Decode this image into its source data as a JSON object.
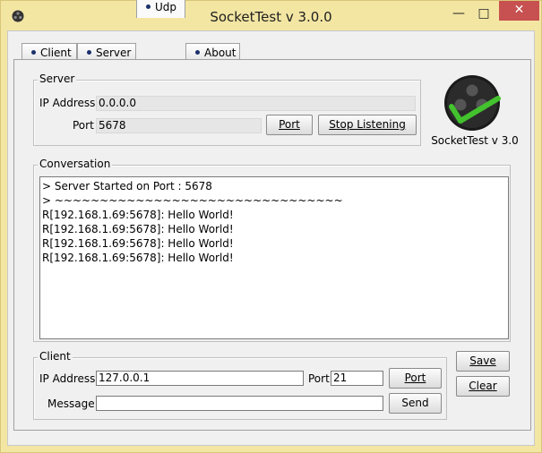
{
  "window": {
    "title": "SocketTest v 3.0.0"
  },
  "tabs": [
    {
      "label": "Client"
    },
    {
      "label": "Server"
    },
    {
      "label": "Udp"
    },
    {
      "label": "About"
    }
  ],
  "server": {
    "group_label": "Server",
    "ip_label": "IP Address",
    "ip_value": "0.0.0.0",
    "port_label": "Port",
    "port_value": "5678",
    "port_button": "Port",
    "stop_button": "Stop Listening"
  },
  "logo": {
    "caption": "SocketTest v 3.0"
  },
  "conversation": {
    "group_label": "Conversation",
    "lines": [
      "> Server Started on Port : 5678",
      "> ~~~~~~~~~~~~~~~~~~~~~~~~~~~~~~~~",
      "R[192.168.1.69:5678]: Hello World!",
      "R[192.168.1.69:5678]: Hello World!",
      "R[192.168.1.69:5678]: Hello World!",
      "R[192.168.1.69:5678]: Hello World!"
    ]
  },
  "client": {
    "group_label": "Client",
    "ip_label": "IP Address",
    "ip_value": "127.0.0.1",
    "port_label": "Port",
    "port_value": "21",
    "port_button": "Port",
    "message_label": "Message",
    "message_value": "",
    "send_button": "Send"
  },
  "actions": {
    "save_button": "Save",
    "clear_button": "Clear"
  }
}
